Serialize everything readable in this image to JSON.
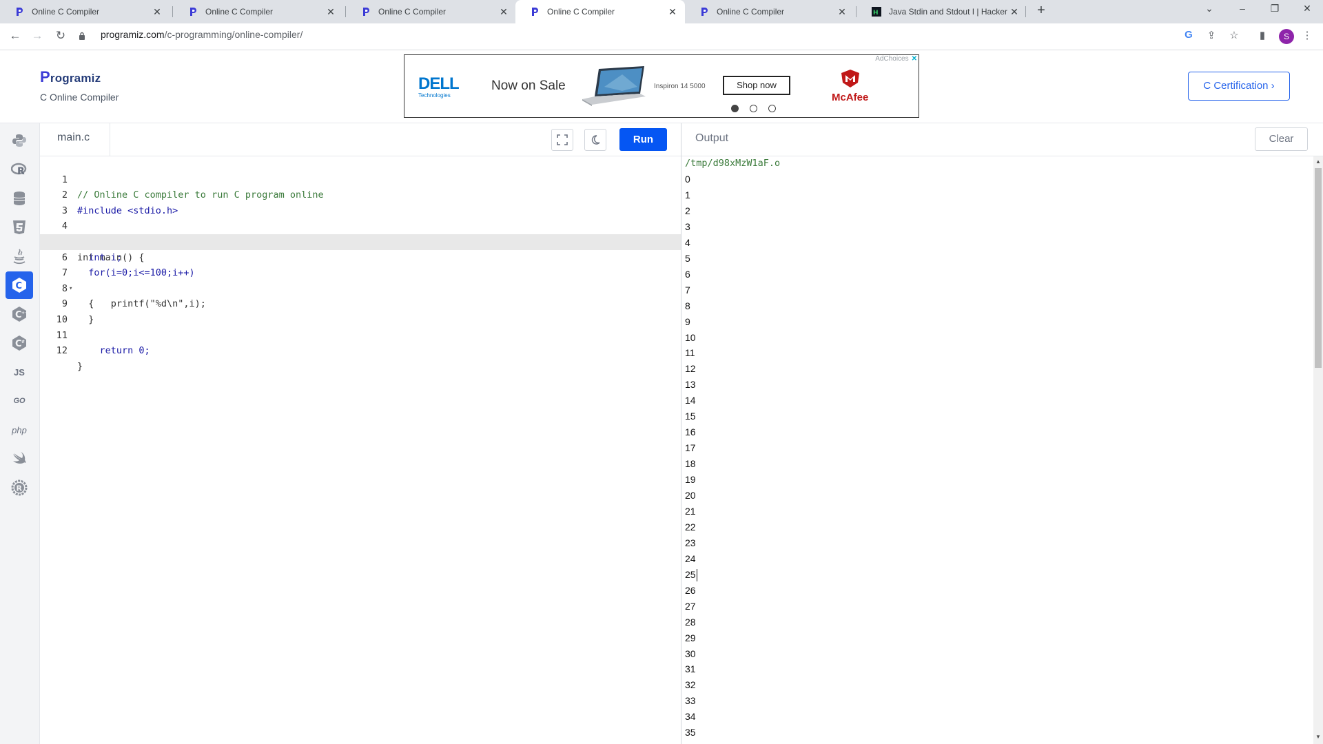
{
  "browser": {
    "tabs": [
      {
        "title": "Online C Compiler",
        "active": false,
        "icon": "programiz-favicon"
      },
      {
        "title": "Online C Compiler",
        "active": false,
        "icon": "programiz-favicon"
      },
      {
        "title": "Online C Compiler",
        "active": false,
        "icon": "programiz-favicon"
      },
      {
        "title": "Online C Compiler",
        "active": true,
        "icon": "programiz-favicon"
      },
      {
        "title": "Online C Compiler",
        "active": false,
        "icon": "programiz-favicon"
      },
      {
        "title": "Java Stdin and Stdout I | HackerR",
        "active": false,
        "icon": "hackerrank-favicon"
      }
    ],
    "url_host": "programiz.com",
    "url_path": "/c-programming/online-compiler/",
    "profile_initial": "S"
  },
  "site": {
    "logo_text": "rogramiz",
    "logo_letter": "P",
    "subtitle": "C Online Compiler",
    "certification_label": "C Certification ›"
  },
  "ad": {
    "brand": "DELL",
    "brand_sub": "Technologies",
    "headline": "Now on Sale",
    "model": "Inspiron 14 5000",
    "cta": "Shop now",
    "partner": "McAfee",
    "adchoices": "AdChoices"
  },
  "editor": {
    "file_name": "main.c",
    "run_label": "Run",
    "highlighted_line": 6,
    "lines": [
      {
        "n": "1",
        "fold": "",
        "code": "// Online C compiler to run C program online"
      },
      {
        "n": "2",
        "fold": "",
        "code": "#include <stdio.h>"
      },
      {
        "n": "3",
        "fold": "",
        "code": ""
      },
      {
        "n": "4",
        "fold": "▾",
        "code": "int main() {"
      },
      {
        "n": "5",
        "fold": "",
        "code": "  int i;"
      },
      {
        "n": "6",
        "fold": "",
        "code": "  for(i=0;i<=100;i++)"
      },
      {
        "n": "7",
        "fold": "▾",
        "code": "  {"
      },
      {
        "n": "8",
        "fold": "",
        "code": "      printf(\"%d\\n\",i);"
      },
      {
        "n": "9",
        "fold": "",
        "code": "  }"
      },
      {
        "n": "10",
        "fold": "",
        "code": ""
      },
      {
        "n": "11",
        "fold": "",
        "code": "    return 0;"
      },
      {
        "n": "12",
        "fold": "",
        "code": "}"
      }
    ]
  },
  "output": {
    "title": "Output",
    "clear_label": "Clear",
    "path": "/tmp/d98xMzW1aF.o",
    "lines": [
      "0",
      "1",
      "2",
      "3",
      "4",
      "5",
      "6",
      "7",
      "8",
      "9",
      "10",
      "11",
      "12",
      "13",
      "14",
      "15",
      "16",
      "17",
      "18",
      "19",
      "20",
      "21",
      "22",
      "23",
      "24",
      "25",
      "26",
      "27",
      "28",
      "29",
      "30",
      "31",
      "32",
      "33",
      "34",
      "35"
    ]
  },
  "rail": [
    {
      "name": "python-icon",
      "label": "",
      "active": false
    },
    {
      "name": "r-icon",
      "label": "R",
      "active": false
    },
    {
      "name": "sql-icon",
      "label": "",
      "active": false
    },
    {
      "name": "html-icon",
      "label": "5",
      "active": false
    },
    {
      "name": "java-icon",
      "label": "",
      "active": false
    },
    {
      "name": "c-icon",
      "label": "C",
      "active": true
    },
    {
      "name": "cpp-icon",
      "label": "C",
      "active": false
    },
    {
      "name": "csharp-icon",
      "label": "C",
      "active": false
    },
    {
      "name": "javascript-icon",
      "label": "JS",
      "active": false
    },
    {
      "name": "go-icon",
      "label": "GO",
      "active": false
    },
    {
      "name": "php-icon",
      "label": "php",
      "active": false
    },
    {
      "name": "swift-icon",
      "label": "",
      "active": false
    },
    {
      "name": "rust-icon",
      "label": "R",
      "active": false
    }
  ],
  "colors": {
    "accent": "#0556f3",
    "rail_active": "#2563eb"
  }
}
